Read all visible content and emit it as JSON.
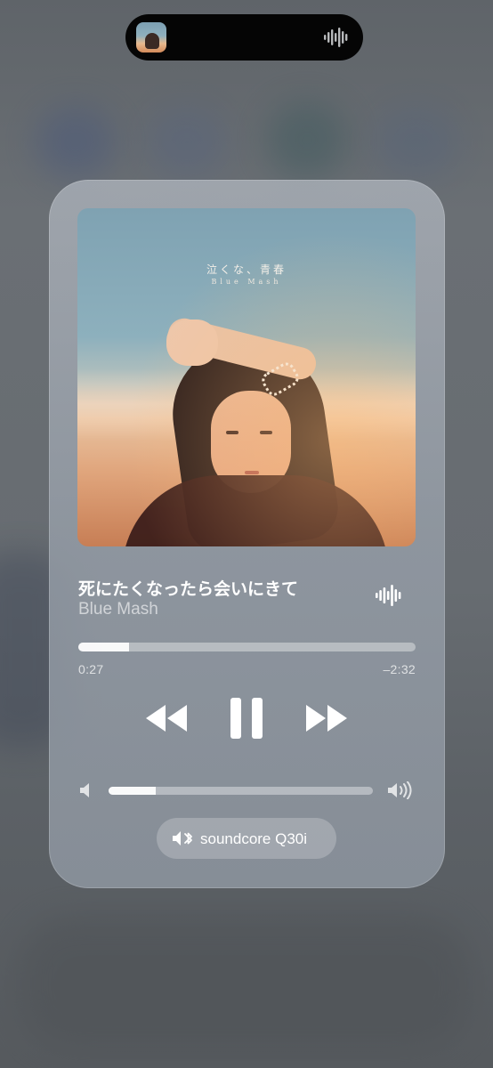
{
  "dynamic_island": {
    "artwork_icon": "album-thumbnail",
    "activity_icon": "waveform-icon"
  },
  "now_playing": {
    "album_art": {
      "title_text": "泣くな、青春",
      "subtitle_text": "Blue Mash"
    },
    "song_title": "死にたくなったら会いにきて",
    "artist": "Blue Mash",
    "playback_icon": "waveform-icon",
    "progress": {
      "elapsed": "0:27",
      "remaining": "–2:32",
      "fraction": 0.15
    },
    "controls": {
      "rewind_icon": "rewind-icon",
      "pause_icon": "pause-icon",
      "forward_icon": "fast-forward-icon"
    },
    "volume": {
      "fraction": 0.18,
      "low_icon": "speaker-low-icon",
      "high_icon": "speaker-high-icon"
    },
    "output_device": {
      "icon": "bluetooth-speaker-icon",
      "label": "soundcore Q30i"
    }
  },
  "colors": {
    "background": "#676c71",
    "card": "#9aa1aa",
    "text_primary": "#ffffff"
  }
}
